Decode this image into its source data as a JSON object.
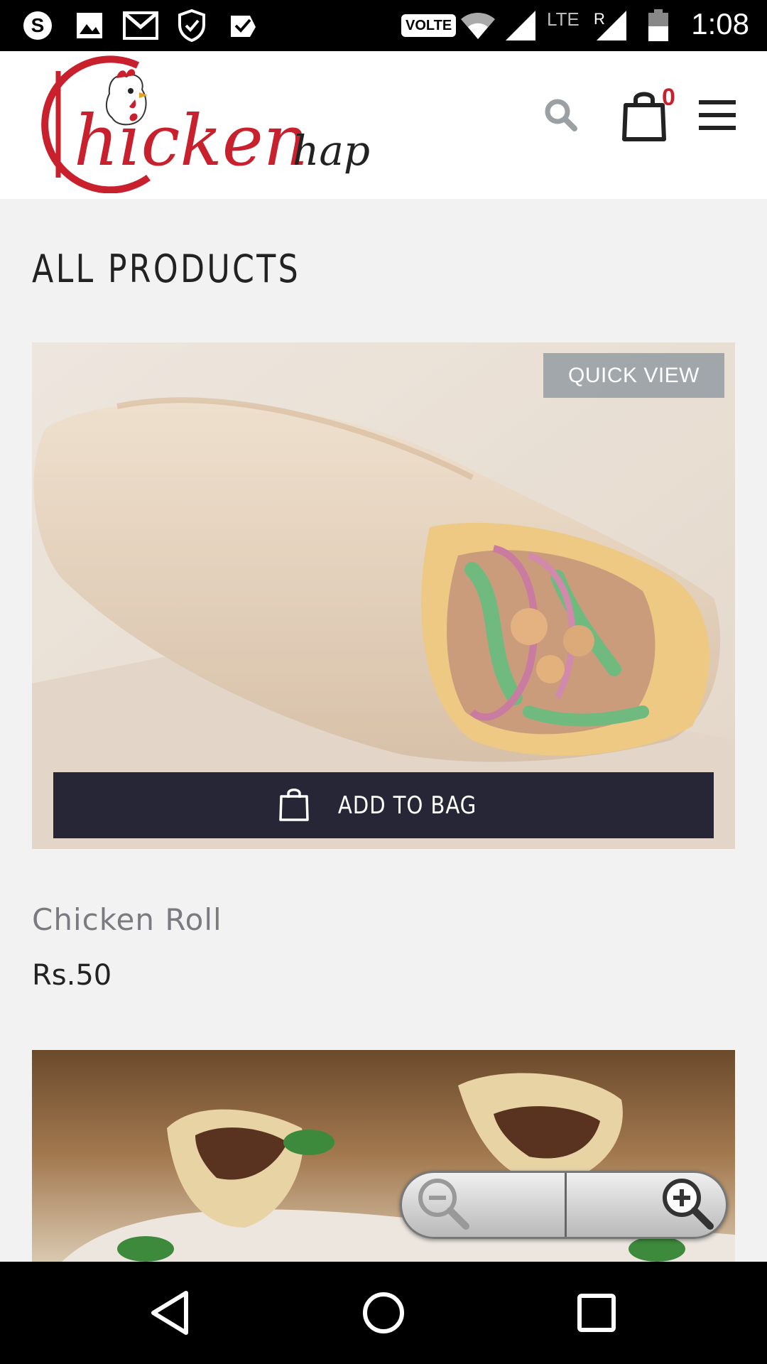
{
  "status_bar": {
    "time": "1:08",
    "network_badge": "VOLTE",
    "network_type": "LTE",
    "roaming": "R",
    "icons": [
      "skype-icon",
      "image-icon",
      "gmail-icon",
      "shield-icon",
      "checkmark-icon",
      "wifi-icon",
      "signal-icon",
      "battery-icon"
    ]
  },
  "header": {
    "logo_text_main": "hicken",
    "logo_text_suffix": "hap",
    "logo_initial": "C",
    "cart_count": "0",
    "brand_color": "#c8202d"
  },
  "main": {
    "page_title": "ALL PRODUCTS",
    "products": [
      {
        "quick_view_label": "QUICK VIEW",
        "add_to_bag_label": "ADD TO BAG",
        "name": "Chicken Roll",
        "price": "Rs.50"
      }
    ]
  },
  "zoom": {
    "out_icon": "zoom-out-icon",
    "in_icon": "zoom-in-icon"
  },
  "nav_bar": {
    "icons": [
      "back-icon",
      "home-icon",
      "recents-icon"
    ]
  }
}
